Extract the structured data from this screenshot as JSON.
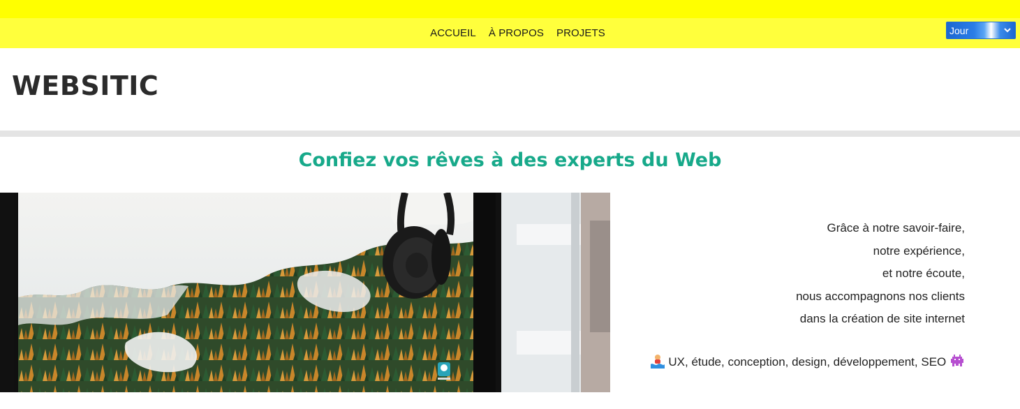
{
  "nav": {
    "links": [
      "ACCUEIL",
      "À PROPOS",
      "PROJETS"
    ],
    "theme_select": {
      "selected": "Jour"
    }
  },
  "header": {
    "brand": "WEBSITIC"
  },
  "main": {
    "headline": "Confiez vos rêves à des experts du Web",
    "hero_image": {
      "icon": "laptop-photo-forest-headphones"
    },
    "intro_lines": [
      "Grâce à notre savoir-faire,",
      "notre expérience,",
      "et notre écoute,",
      "nous accompagnons nos clients",
      "dans la création de site internet"
    ],
    "services_text": "UX, étude, conception, design, développement, SEO",
    "services_icons": [
      "person-in-water-emoji",
      "alien-monster-emoji"
    ]
  },
  "colors": {
    "top_strip": "#ffff00",
    "navbar": "#ffff3c",
    "headline": "#17a98a",
    "divider": "#e4e4e4",
    "select": "#1c67d2"
  }
}
